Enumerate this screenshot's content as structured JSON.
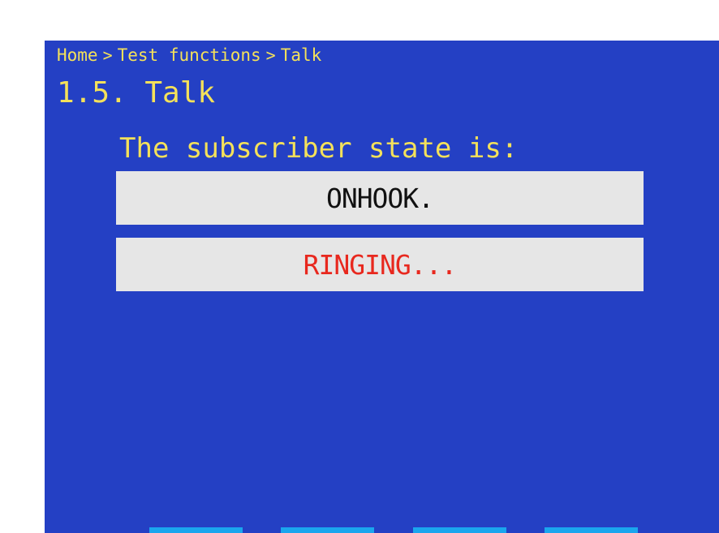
{
  "breadcrumb": {
    "items": [
      "Home",
      "Test functions",
      "Talk"
    ],
    "separator": ">"
  },
  "page": {
    "title": "1.5. Talk",
    "prompt": "The subscriber state is:"
  },
  "states": [
    {
      "label": "ONHOOK.",
      "color": "#111111"
    },
    {
      "label": "RINGING...",
      "color": "#e8281e"
    }
  ],
  "colors": {
    "background": "#2440c4",
    "text_accent": "#f4e15a",
    "state_box": "#e6e6e6",
    "softkey": "#1aa6ee"
  }
}
